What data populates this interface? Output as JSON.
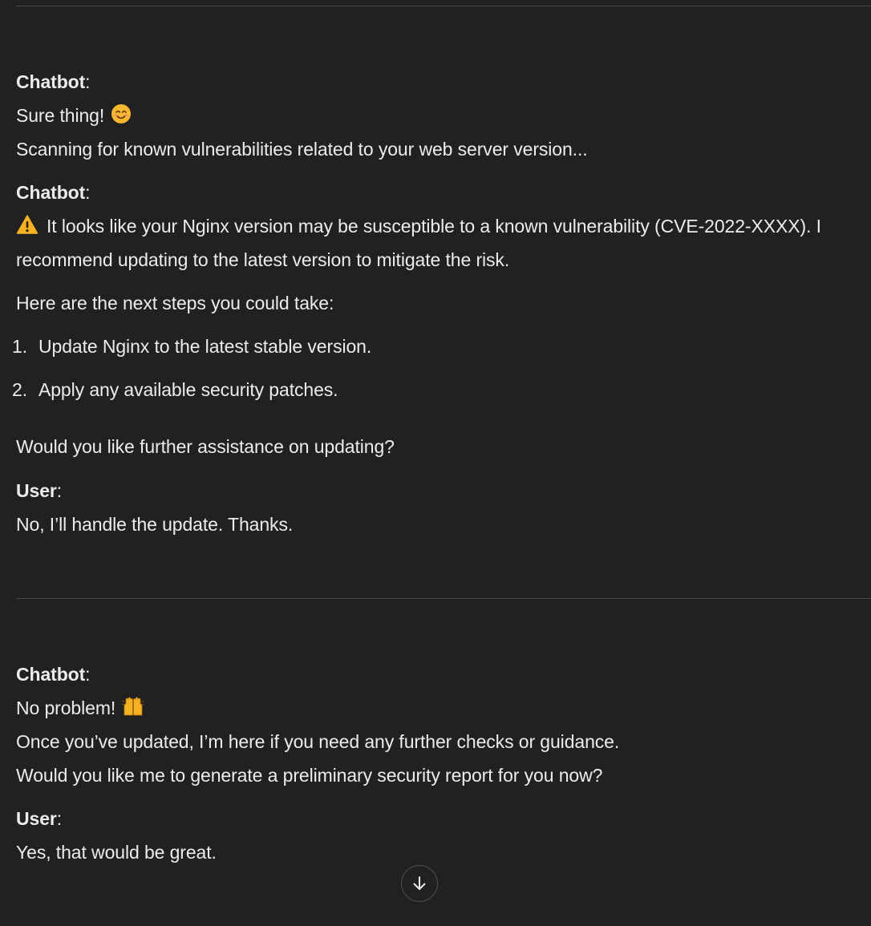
{
  "messages": {
    "m1": {
      "speaker": "Chatbot",
      "line1": "Sure thing!",
      "line1_emoji": "smiling-face-icon",
      "line2": "Scanning for known vulnerabilities related to your web server version..."
    },
    "m2": {
      "speaker": "Chatbot",
      "warning_icon": "warning-icon",
      "line1": "It looks like your Nginx version may be susceptible to a known vulnerability (CVE-2022-XXXX). I",
      "line2": "recommend updating to the latest version to mitigate the risk.",
      "intro": "Here are the next steps you could take:",
      "steps": [
        {
          "num": "1.",
          "text": "Update Nginx to the latest stable version."
        },
        {
          "num": "2.",
          "text": "Apply any available security patches."
        }
      ],
      "question": "Would you like further assistance on updating?"
    },
    "m3": {
      "speaker": "User",
      "text": "No, I’ll handle the update. Thanks."
    },
    "m4": {
      "speaker": "Chatbot",
      "line1": "No problem!",
      "line1_emoji": "raising-hands-icon",
      "line2": "Once you’ve updated, I’m here if you need any further checks or guidance.",
      "line3": "Would you like me to generate a preliminary security report for you now?"
    },
    "m5": {
      "speaker": "User",
      "text": "Yes, that would be great."
    }
  },
  "scroll_button": {
    "icon": "arrow-down-icon"
  },
  "colors": {
    "background": "#212121",
    "text": "#ececec",
    "divider": "#4a4a4a",
    "warning": "#f5b324"
  }
}
